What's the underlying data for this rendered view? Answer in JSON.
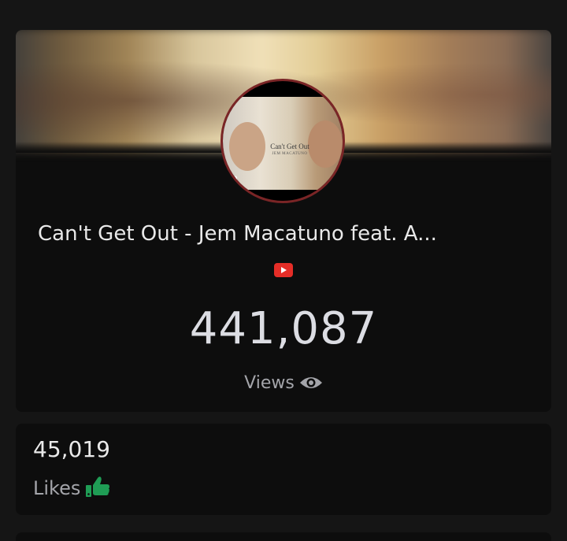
{
  "video": {
    "title": "Can't Get Out - Jem Macatuno feat. A...",
    "thumbnail_title": "Can't Get Out",
    "thumbnail_subtitle": "JEM MACATUNO",
    "thumbnail_tag": "pp",
    "source_icon": "youtube-icon",
    "source_color": "#e52d27"
  },
  "views": {
    "count": "441,087",
    "label": "Views",
    "icon": "eye-icon"
  },
  "likes": {
    "count": "45,019",
    "label": "Likes",
    "icon": "thumbs-up-icon",
    "icon_color": "#1f9d55"
  }
}
